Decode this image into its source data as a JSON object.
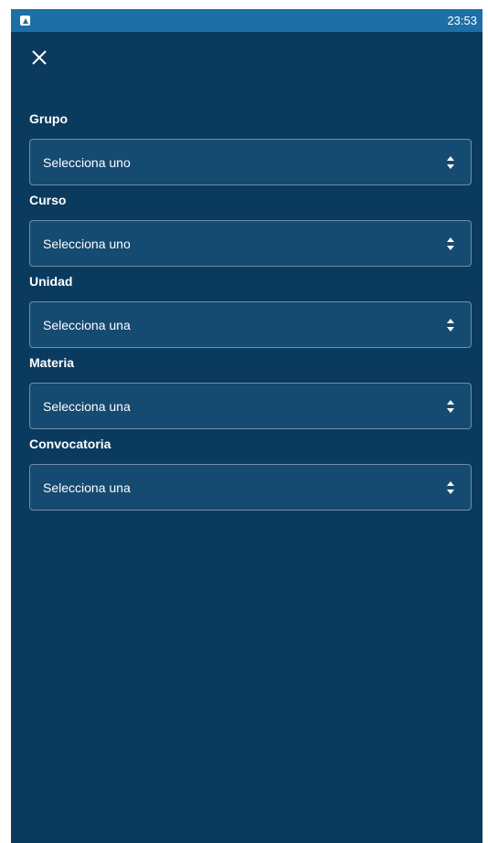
{
  "status_bar": {
    "time": "23:53"
  },
  "form": {
    "fields": [
      {
        "label": "Grupo",
        "value": "Selecciona uno"
      },
      {
        "label": "Curso",
        "value": "Selecciona uno"
      },
      {
        "label": "Unidad",
        "value": "Selecciona una"
      },
      {
        "label": "Materia",
        "value": "Selecciona una"
      },
      {
        "label": "Convocatoria",
        "value": "Selecciona una"
      }
    ]
  },
  "colors": {
    "background": "#0a3a5e",
    "status_bar": "#1e6fa7",
    "field": "#154a71",
    "field_border": "#6f8faa"
  }
}
